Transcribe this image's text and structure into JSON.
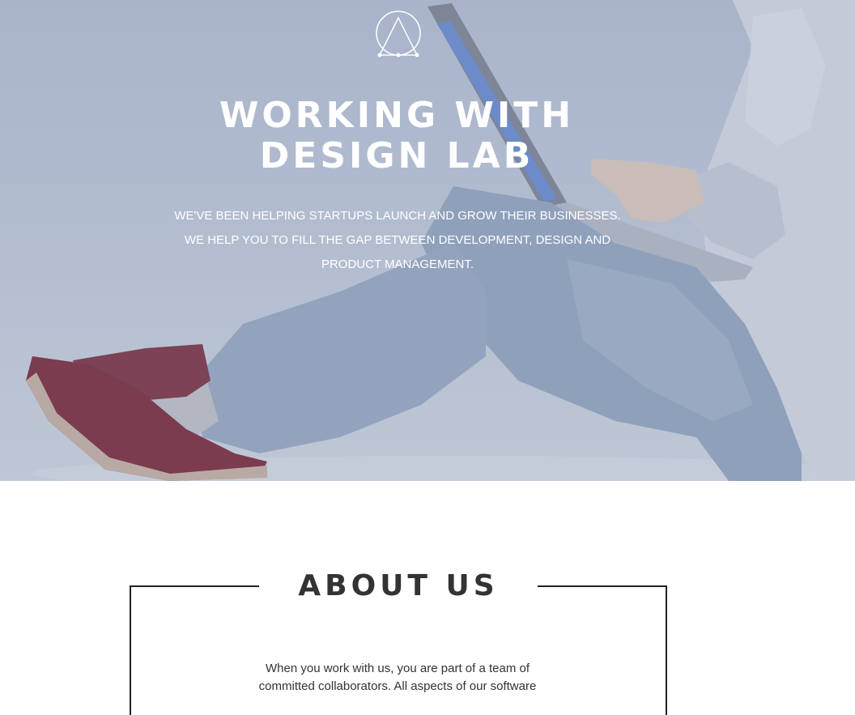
{
  "hero": {
    "title_line1": "WORKING WITH",
    "title_line2": "DESIGN LAB",
    "text_line1": "WE'VE BEEN HELPING STARTUPS LAUNCH AND GROW THEIR BUSINESSES.",
    "text_line2": "WE HELP YOU TO FILL THE GAP BETWEEN DEVELOPMENT, DESIGN AND",
    "text_line3": "PRODUCT MANAGEMENT.",
    "logo_icon": "triangle-circle-logo-icon",
    "overlay_color": "#a9b4cb"
  },
  "about": {
    "title": "ABOUT US",
    "text_line1": "When you work with us, you are part of a team of",
    "text_line2": "committed collaborators. All aspects of our software"
  }
}
